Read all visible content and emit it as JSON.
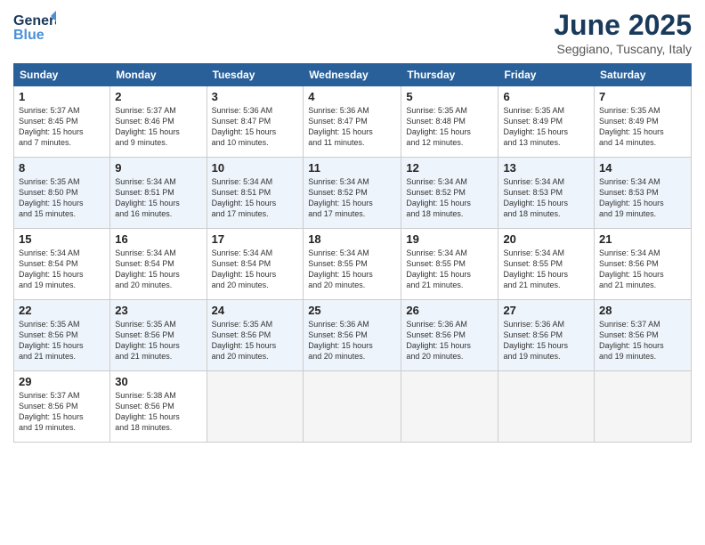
{
  "logo": {
    "line1": "General",
    "line2": "Blue"
  },
  "title": "June 2025",
  "location": "Seggiano, Tuscany, Italy",
  "weekdays": [
    "Sunday",
    "Monday",
    "Tuesday",
    "Wednesday",
    "Thursday",
    "Friday",
    "Saturday"
  ],
  "weeks": [
    [
      {
        "day": "1",
        "info": "Sunrise: 5:37 AM\nSunset: 8:45 PM\nDaylight: 15 hours\nand 7 minutes."
      },
      {
        "day": "2",
        "info": "Sunrise: 5:37 AM\nSunset: 8:46 PM\nDaylight: 15 hours\nand 9 minutes."
      },
      {
        "day": "3",
        "info": "Sunrise: 5:36 AM\nSunset: 8:47 PM\nDaylight: 15 hours\nand 10 minutes."
      },
      {
        "day": "4",
        "info": "Sunrise: 5:36 AM\nSunset: 8:47 PM\nDaylight: 15 hours\nand 11 minutes."
      },
      {
        "day": "5",
        "info": "Sunrise: 5:35 AM\nSunset: 8:48 PM\nDaylight: 15 hours\nand 12 minutes."
      },
      {
        "day": "6",
        "info": "Sunrise: 5:35 AM\nSunset: 8:49 PM\nDaylight: 15 hours\nand 13 minutes."
      },
      {
        "day": "7",
        "info": "Sunrise: 5:35 AM\nSunset: 8:49 PM\nDaylight: 15 hours\nand 14 minutes."
      }
    ],
    [
      {
        "day": "8",
        "info": "Sunrise: 5:35 AM\nSunset: 8:50 PM\nDaylight: 15 hours\nand 15 minutes."
      },
      {
        "day": "9",
        "info": "Sunrise: 5:34 AM\nSunset: 8:51 PM\nDaylight: 15 hours\nand 16 minutes."
      },
      {
        "day": "10",
        "info": "Sunrise: 5:34 AM\nSunset: 8:51 PM\nDaylight: 15 hours\nand 17 minutes."
      },
      {
        "day": "11",
        "info": "Sunrise: 5:34 AM\nSunset: 8:52 PM\nDaylight: 15 hours\nand 17 minutes."
      },
      {
        "day": "12",
        "info": "Sunrise: 5:34 AM\nSunset: 8:52 PM\nDaylight: 15 hours\nand 18 minutes."
      },
      {
        "day": "13",
        "info": "Sunrise: 5:34 AM\nSunset: 8:53 PM\nDaylight: 15 hours\nand 18 minutes."
      },
      {
        "day": "14",
        "info": "Sunrise: 5:34 AM\nSunset: 8:53 PM\nDaylight: 15 hours\nand 19 minutes."
      }
    ],
    [
      {
        "day": "15",
        "info": "Sunrise: 5:34 AM\nSunset: 8:54 PM\nDaylight: 15 hours\nand 19 minutes."
      },
      {
        "day": "16",
        "info": "Sunrise: 5:34 AM\nSunset: 8:54 PM\nDaylight: 15 hours\nand 20 minutes."
      },
      {
        "day": "17",
        "info": "Sunrise: 5:34 AM\nSunset: 8:54 PM\nDaylight: 15 hours\nand 20 minutes."
      },
      {
        "day": "18",
        "info": "Sunrise: 5:34 AM\nSunset: 8:55 PM\nDaylight: 15 hours\nand 20 minutes."
      },
      {
        "day": "19",
        "info": "Sunrise: 5:34 AM\nSunset: 8:55 PM\nDaylight: 15 hours\nand 21 minutes."
      },
      {
        "day": "20",
        "info": "Sunrise: 5:34 AM\nSunset: 8:55 PM\nDaylight: 15 hours\nand 21 minutes."
      },
      {
        "day": "21",
        "info": "Sunrise: 5:34 AM\nSunset: 8:56 PM\nDaylight: 15 hours\nand 21 minutes."
      }
    ],
    [
      {
        "day": "22",
        "info": "Sunrise: 5:35 AM\nSunset: 8:56 PM\nDaylight: 15 hours\nand 21 minutes."
      },
      {
        "day": "23",
        "info": "Sunrise: 5:35 AM\nSunset: 8:56 PM\nDaylight: 15 hours\nand 21 minutes."
      },
      {
        "day": "24",
        "info": "Sunrise: 5:35 AM\nSunset: 8:56 PM\nDaylight: 15 hours\nand 20 minutes."
      },
      {
        "day": "25",
        "info": "Sunrise: 5:36 AM\nSunset: 8:56 PM\nDaylight: 15 hours\nand 20 minutes."
      },
      {
        "day": "26",
        "info": "Sunrise: 5:36 AM\nSunset: 8:56 PM\nDaylight: 15 hours\nand 20 minutes."
      },
      {
        "day": "27",
        "info": "Sunrise: 5:36 AM\nSunset: 8:56 PM\nDaylight: 15 hours\nand 19 minutes."
      },
      {
        "day": "28",
        "info": "Sunrise: 5:37 AM\nSunset: 8:56 PM\nDaylight: 15 hours\nand 19 minutes."
      }
    ],
    [
      {
        "day": "29",
        "info": "Sunrise: 5:37 AM\nSunset: 8:56 PM\nDaylight: 15 hours\nand 19 minutes."
      },
      {
        "day": "30",
        "info": "Sunrise: 5:38 AM\nSunset: 8:56 PM\nDaylight: 15 hours\nand 18 minutes."
      },
      {
        "day": "",
        "info": ""
      },
      {
        "day": "",
        "info": ""
      },
      {
        "day": "",
        "info": ""
      },
      {
        "day": "",
        "info": ""
      },
      {
        "day": "",
        "info": ""
      }
    ]
  ]
}
